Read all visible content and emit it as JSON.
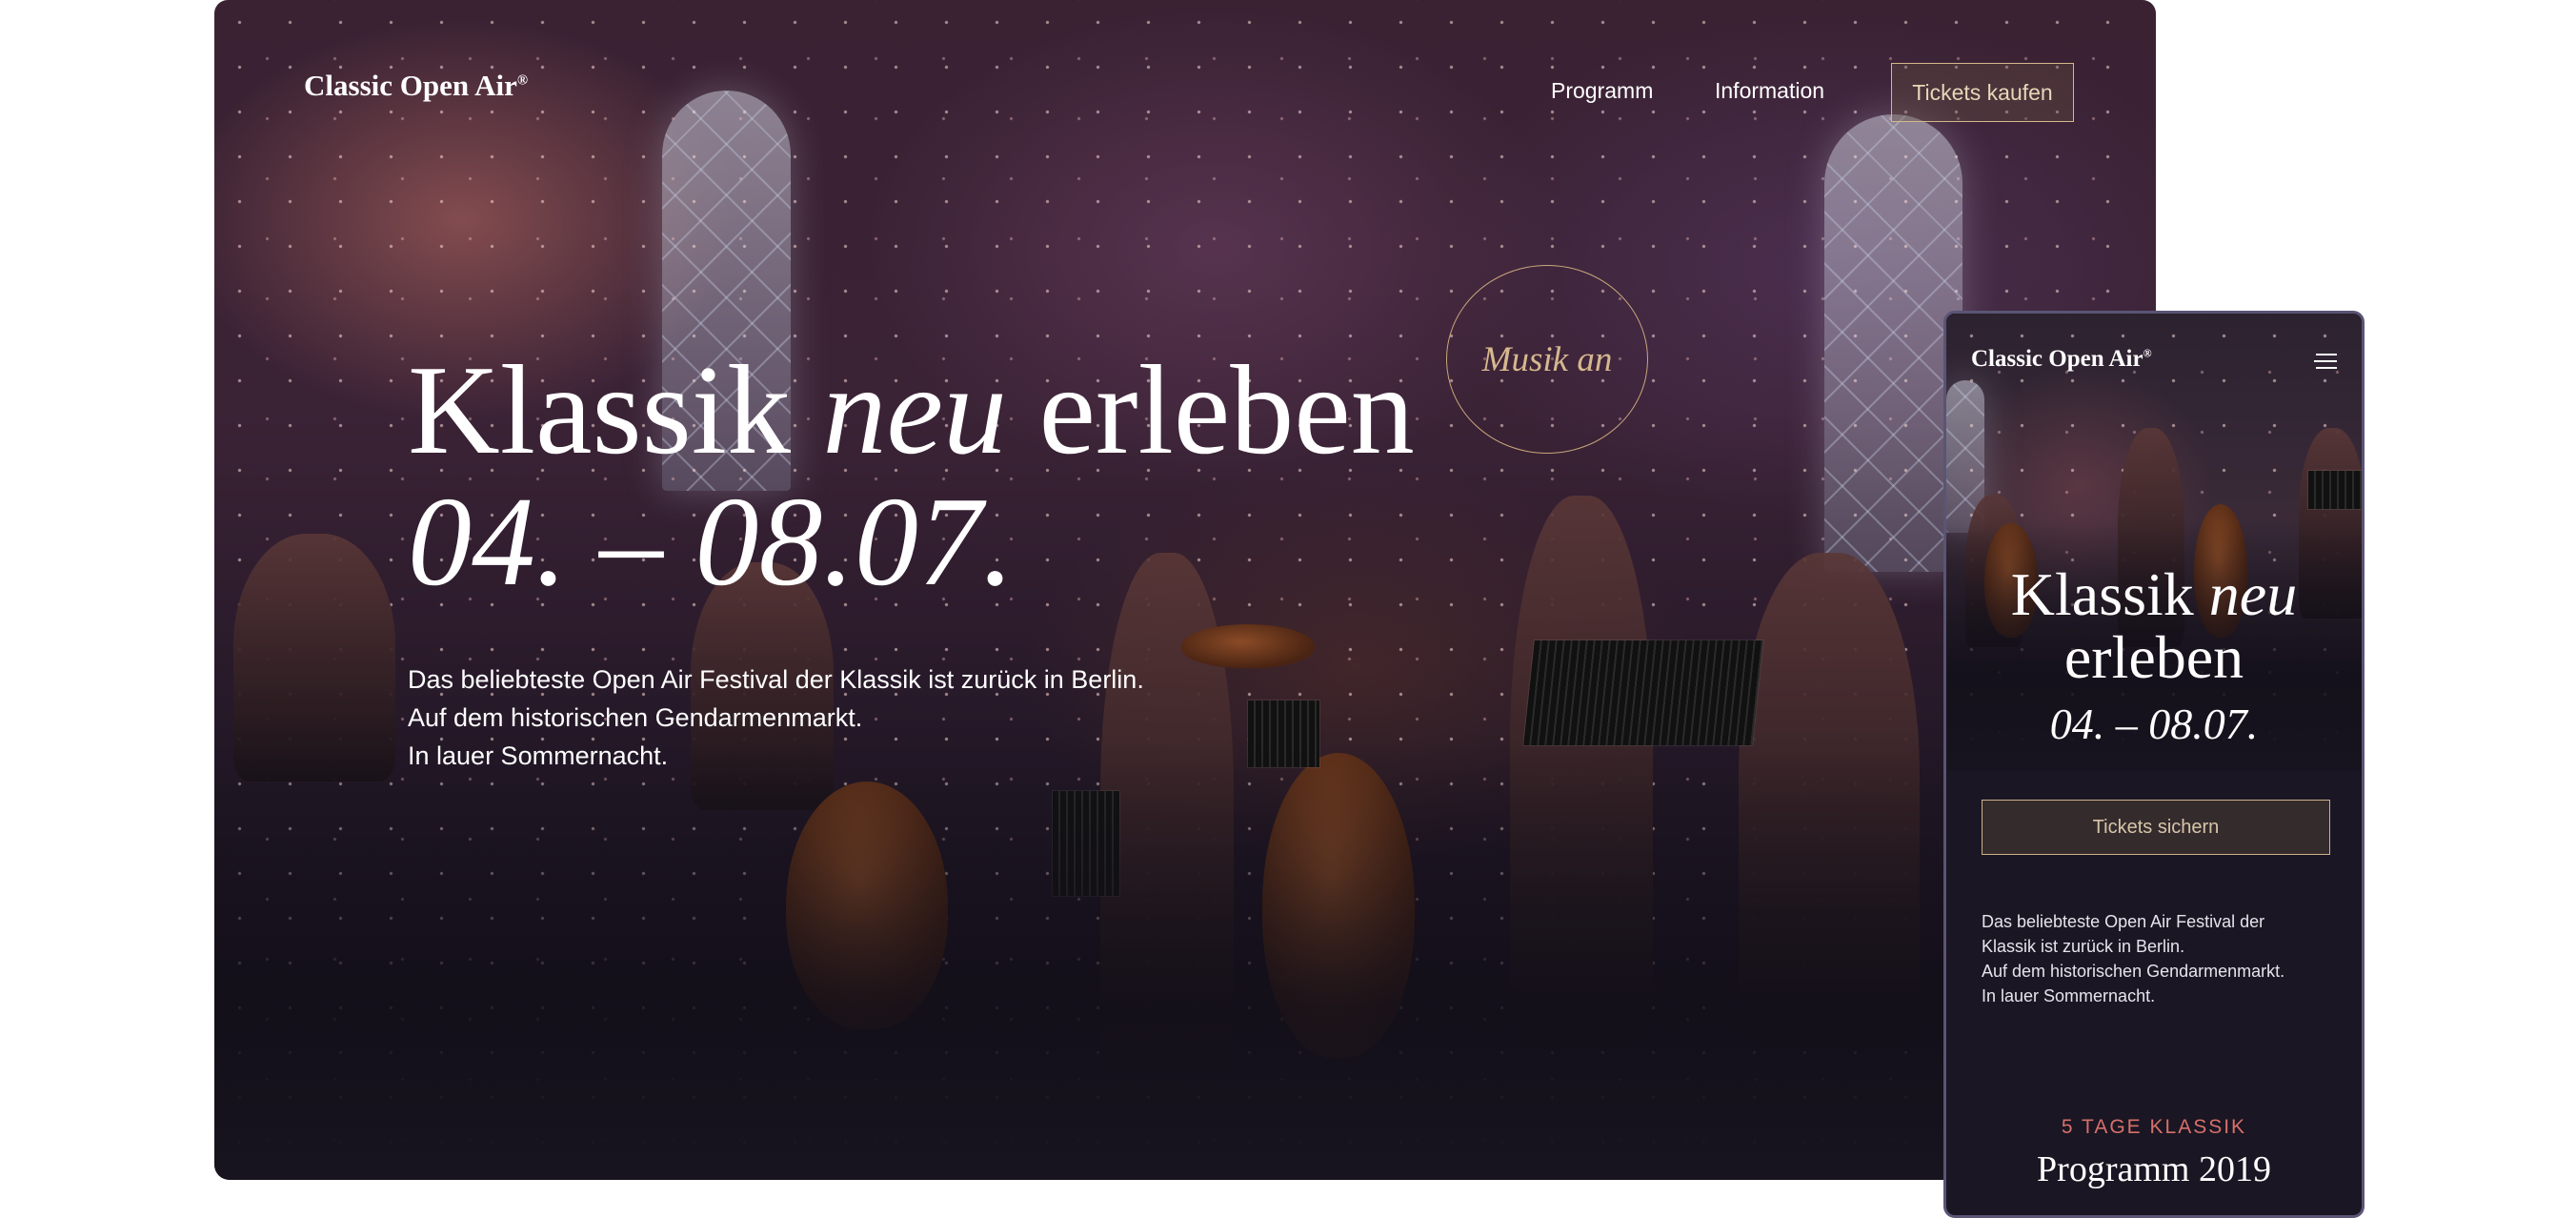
{
  "desktop": {
    "logo": "Classic Open Air",
    "logo_mark": "®",
    "nav": [
      "Programm",
      "Information"
    ],
    "cta": "Tickets kaufen",
    "headline": {
      "part1": "Klassik ",
      "italic": "neu",
      "part2": " erleben"
    },
    "dates": "04. – 08.07.",
    "intro": [
      "Das beliebteste Open Air Festival der Klassik ist zurück in Berlin.",
      "Auf dem historischen Gendarmenmarkt.",
      "In lauer Sommernacht."
    ],
    "sound_toggle": "Musik an"
  },
  "mobile": {
    "logo": "Classic Open Air",
    "logo_mark": "®",
    "menu_icon": "hamburger-icon",
    "headline": {
      "part1": "Klassik ",
      "italic": "neu",
      "part2": "erleben"
    },
    "dates": "04. – 08.07.",
    "cta": "Tickets sichern",
    "intro": [
      "Das beliebteste Open Air Festival der",
      "Klassik ist zurück in Berlin.",
      "Auf dem historischen Gendarmenmarkt.",
      "In lauer Sommernacht."
    ],
    "kicker": "5 TAGE KLASSIK",
    "section_title": "Programm 2019"
  },
  "colors": {
    "accent_gold": "#d4b78c",
    "kicker_red": "#d6706a",
    "dark_bg": "#1a1623"
  }
}
